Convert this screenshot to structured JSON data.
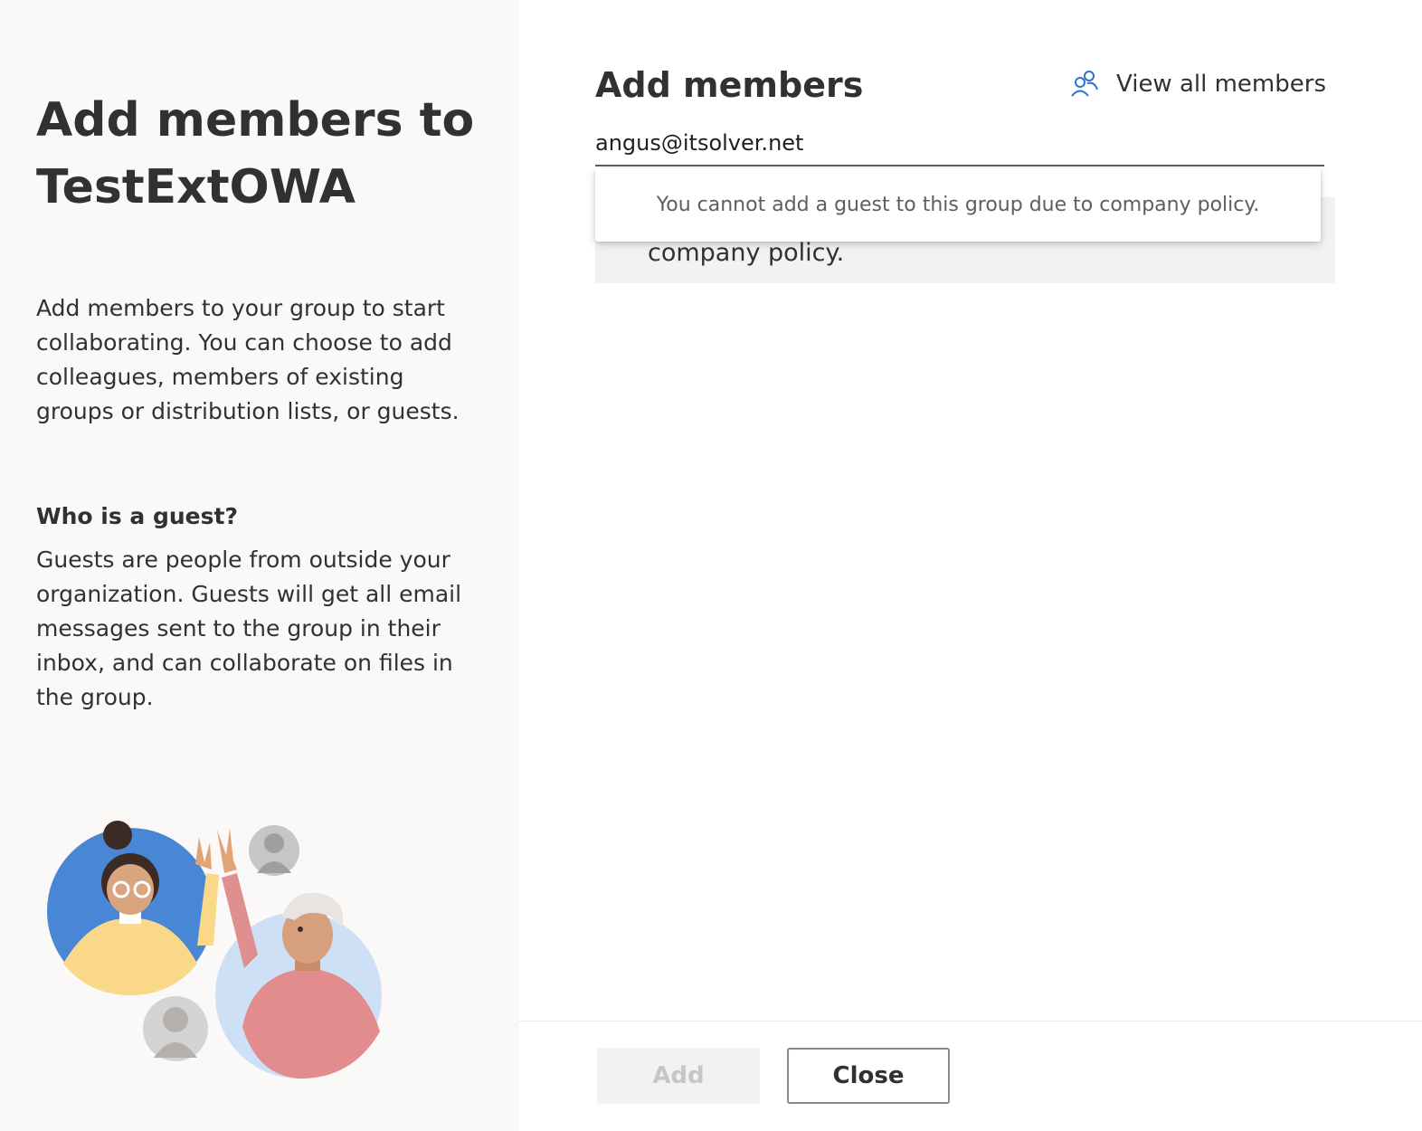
{
  "left_panel": {
    "title": "Add members to TestExtOWA",
    "description": "Add members to your group to start collaborating. You can choose to add colleagues, members of existing groups or distribution lists, or guests.",
    "guest_heading": "Who is a guest?",
    "guest_description": "Guests are people from outside your organization. Guests will get all email messages sent to the group in their inbox, and can collaborate on files in the group."
  },
  "main": {
    "title": "Add members",
    "view_all_label": "View all members",
    "view_all_icon": "people-icon",
    "member_input_value": "angus@itsolver.net",
    "error_text_partial": "company policy.",
    "tooltip_text": "You cannot add a guest to this group due to company policy."
  },
  "footer": {
    "add_label": "Add",
    "close_label": "Close"
  },
  "colors": {
    "accent": "#2b72d6",
    "left_bg": "#faf9f8",
    "text": "#323130"
  }
}
